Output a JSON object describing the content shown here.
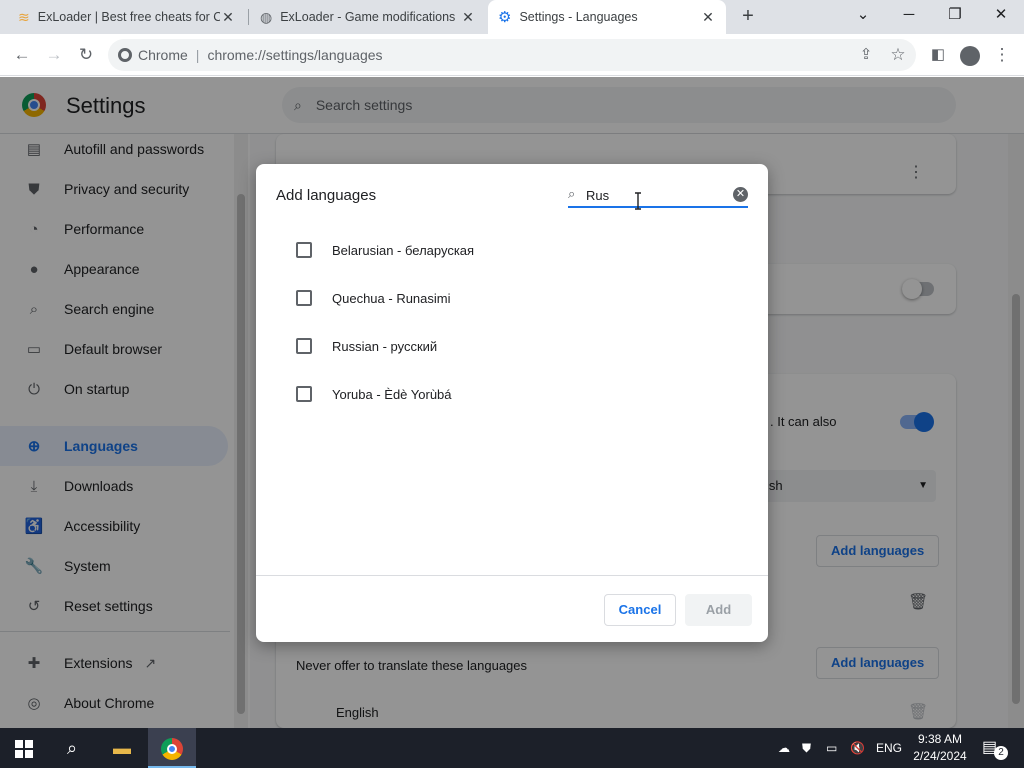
{
  "browser": {
    "tabs": [
      {
        "title": "ExLoader | Best free cheats for CS",
        "active": false
      },
      {
        "title": "ExLoader - Game modifications",
        "active": false
      },
      {
        "title": "Settings - Languages",
        "active": true
      }
    ],
    "omnibox": {
      "site": "Chrome",
      "url": "chrome://settings/languages"
    }
  },
  "settings": {
    "title": "Settings",
    "search_placeholder": "Search settings",
    "nav": [
      {
        "label": "Autofill and passwords",
        "icon": "clipboard-icon"
      },
      {
        "label": "Privacy and security",
        "icon": "shield-icon"
      },
      {
        "label": "Performance",
        "icon": "speedometer-icon"
      },
      {
        "label": "Appearance",
        "icon": "palette-icon"
      },
      {
        "label": "Search engine",
        "icon": "search-icon"
      },
      {
        "label": "Default browser",
        "icon": "browser-icon"
      },
      {
        "label": "On startup",
        "icon": "power-icon"
      },
      {
        "label": "Languages",
        "icon": "globe-icon",
        "selected": true
      },
      {
        "label": "Downloads",
        "icon": "download-icon"
      },
      {
        "label": "Accessibility",
        "icon": "accessibility-icon"
      },
      {
        "label": "System",
        "icon": "wrench-icon"
      },
      {
        "label": "Reset settings",
        "icon": "reset-icon"
      },
      {
        "label": "Extensions",
        "icon": "puzzle-icon"
      },
      {
        "label": "About Chrome",
        "icon": "chrome-icon"
      }
    ],
    "main": {
      "partial_text_1": ". It can also",
      "partial_select": "ish",
      "add_languages_label": "Add languages",
      "never_translate_label": "Never offer to translate these languages",
      "never_translate_item": "English"
    }
  },
  "dialog": {
    "title": "Add languages",
    "search_value": "Rus",
    "languages": [
      {
        "label": "Belarusian - беларуская",
        "checked": false
      },
      {
        "label": "Quechua - Runasimi",
        "checked": false
      },
      {
        "label": "Russian - русский",
        "checked": false
      },
      {
        "label": "Yoruba - Èdè Yorùbá",
        "checked": false
      }
    ],
    "cancel_label": "Cancel",
    "add_label": "Add"
  },
  "taskbar": {
    "language": "ENG",
    "time": "9:38 AM",
    "date": "2/24/2024",
    "notification_count": "2"
  },
  "colors": {
    "accent": "#1a73e8",
    "taskbar": "#1c2029"
  }
}
